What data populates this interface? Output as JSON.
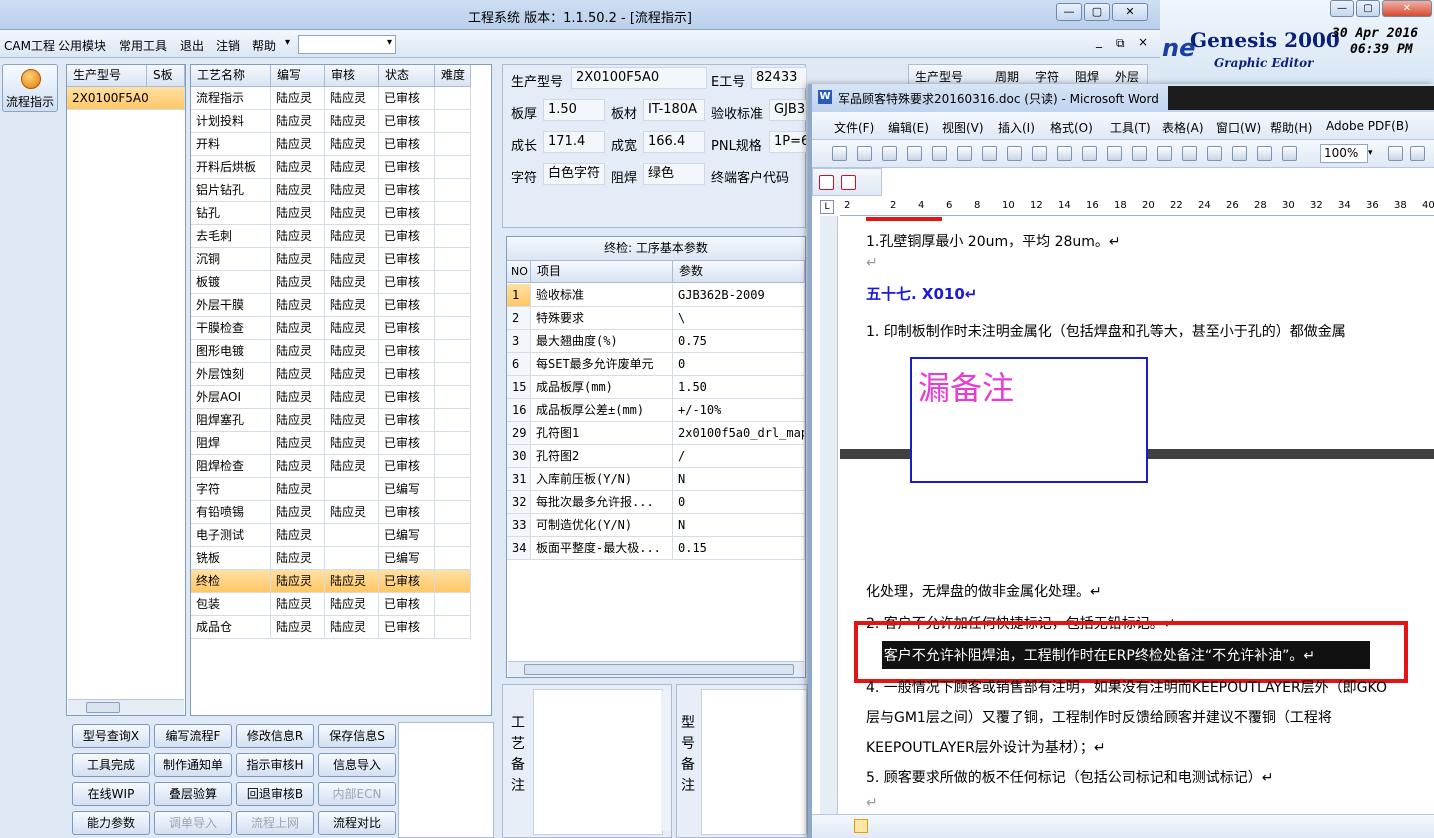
{
  "app": {
    "title": "工程系统   版本：1.1.50.2 - [流程指示]",
    "win_controls": [
      "—",
      "▢",
      "✕"
    ],
    "menu": [
      "CAM工程",
      "公用模块",
      "常用工具",
      "退出",
      "注销",
      "帮助"
    ],
    "menu_arrow": "▾",
    "nav_label": "流程指示",
    "mdi_controls": [
      "_",
      "⧉",
      "×"
    ]
  },
  "left_list": {
    "headers": [
      "生产型号",
      "S板"
    ],
    "rows": [
      {
        "model": "2X0100F5A0",
        "s": ""
      }
    ]
  },
  "process": {
    "headers": [
      "工艺名称",
      "编写",
      "审核",
      "状态",
      "难度"
    ],
    "rows": [
      [
        "流程指示",
        "陆应灵",
        "陆应灵",
        "已审核",
        ""
      ],
      [
        "计划投料",
        "陆应灵",
        "陆应灵",
        "已审核",
        ""
      ],
      [
        "开料",
        "陆应灵",
        "陆应灵",
        "已审核",
        ""
      ],
      [
        "开料后烘板",
        "陆应灵",
        "陆应灵",
        "已审核",
        ""
      ],
      [
        "铝片钻孔",
        "陆应灵",
        "陆应灵",
        "已审核",
        ""
      ],
      [
        "钻孔",
        "陆应灵",
        "陆应灵",
        "已审核",
        ""
      ],
      [
        "去毛刺",
        "陆应灵",
        "陆应灵",
        "已审核",
        ""
      ],
      [
        "沉铜",
        "陆应灵",
        "陆应灵",
        "已审核",
        ""
      ],
      [
        "板镀",
        "陆应灵",
        "陆应灵",
        "已审核",
        ""
      ],
      [
        "外层干膜",
        "陆应灵",
        "陆应灵",
        "已审核",
        ""
      ],
      [
        "干膜检查",
        "陆应灵",
        "陆应灵",
        "已审核",
        ""
      ],
      [
        "图形电镀",
        "陆应灵",
        "陆应灵",
        "已审核",
        ""
      ],
      [
        "外层蚀刻",
        "陆应灵",
        "陆应灵",
        "已审核",
        ""
      ],
      [
        "外层AOI",
        "陆应灵",
        "陆应灵",
        "已审核",
        ""
      ],
      [
        "阻焊塞孔",
        "陆应灵",
        "陆应灵",
        "已审核",
        ""
      ],
      [
        "阻焊",
        "陆应灵",
        "陆应灵",
        "已审核",
        ""
      ],
      [
        "阻焊检查",
        "陆应灵",
        "陆应灵",
        "已审核",
        ""
      ],
      [
        "字符",
        "陆应灵",
        "",
        "已编写",
        ""
      ],
      [
        "有铅喷锡",
        "陆应灵",
        "陆应灵",
        "已审核",
        ""
      ],
      [
        "电子测试",
        "陆应灵",
        "",
        "已编写",
        ""
      ],
      [
        "铣板",
        "陆应灵",
        "",
        "已编写",
        ""
      ],
      [
        "终检",
        "陆应灵",
        "陆应灵",
        "已审核",
        ""
      ],
      [
        "包装",
        "陆应灵",
        "陆应灵",
        "已审核",
        ""
      ],
      [
        "成品仓",
        "陆应灵",
        "陆应灵",
        "已审核",
        ""
      ]
    ],
    "selected_index": 21
  },
  "form": {
    "model_label": "生产型号",
    "model": "2X0100F5A0",
    "eno_label": "E工号",
    "eno": "82433",
    "thick_label": "板厚",
    "thick": "1.50",
    "material_label": "板材",
    "material": "IT-180A",
    "std_label": "验收标准",
    "std": "GJB3",
    "len_label": "成长",
    "len": "171.4",
    "wid_label": "成宽",
    "wid": "166.4",
    "pnl_label": "PNL规格",
    "pnl": "1P=6",
    "char_label": "字符",
    "char": "白色字符",
    "mask_label": "阻焊",
    "mask": "绿色",
    "cust_label": "终端客户代码",
    "hdr2": [
      "生产型号",
      "周期",
      "字符",
      "阻焊",
      "外层"
    ]
  },
  "params": {
    "title": "终检: 工序基本参数",
    "headers": [
      "NO",
      "项目",
      "参数"
    ],
    "rows": [
      [
        "1",
        "验收标准",
        "GJB362B-2009"
      ],
      [
        "2",
        "特殊要求",
        "\\"
      ],
      [
        "3",
        "最大翘曲度(%)",
        "0.75"
      ],
      [
        "6",
        "每SET最多允许废单元",
        "0"
      ],
      [
        "15",
        "成品板厚(mm)",
        "1.50"
      ],
      [
        "16",
        "成品板厚公差±(mm)",
        "+/-10%"
      ],
      [
        "29",
        "孔符图1",
        "2x0100f5a0_drl_map."
      ],
      [
        "30",
        "孔符图2",
        "/"
      ],
      [
        "31",
        "入库前压板(Y/N)",
        "N"
      ],
      [
        "32",
        "每批次最多允许报...",
        "0"
      ],
      [
        "33",
        "可制造优化(Y/N)",
        "N"
      ],
      [
        "34",
        "板面平整度-最大极...",
        "0.15"
      ]
    ]
  },
  "buttons": [
    {
      "label": "型号查询X",
      "enabled": true
    },
    {
      "label": "编写流程F",
      "enabled": true
    },
    {
      "label": "修改信息R",
      "enabled": true
    },
    {
      "label": "保存信息S",
      "enabled": true
    },
    {
      "label": "工具完成",
      "enabled": true
    },
    {
      "label": "制作通知单",
      "enabled": true
    },
    {
      "label": "指示审核H",
      "enabled": true
    },
    {
      "label": "信息导入",
      "enabled": true
    },
    {
      "label": "在线WIP",
      "enabled": true
    },
    {
      "label": "叠层验算",
      "enabled": true
    },
    {
      "label": "回退审核B",
      "enabled": true
    },
    {
      "label": "内部ECN",
      "enabled": false
    },
    {
      "label": "能力参数",
      "enabled": true
    },
    {
      "label": "调单导入",
      "enabled": false
    },
    {
      "label": "流程上网",
      "enabled": false
    },
    {
      "label": "流程对比",
      "enabled": true
    }
  ],
  "notes": {
    "process_note": "工艺备注",
    "model_note": "型号备注"
  },
  "genesis": {
    "title": "Genesis 2000",
    "subtitle": "Graphic Editor",
    "date": "30 Apr 2016",
    "time": "06:39 PM",
    "partial": "ne"
  },
  "word": {
    "title": "军品顾客特殊要求20160316.doc (只读) - Microsoft Word",
    "menu": [
      "文件(F)",
      "编辑(E)",
      "视图(V)",
      "插入(I)",
      "格式(O)",
      "工具(T)",
      "表格(A)",
      "窗口(W)",
      "帮助(H)",
      "Adobe PDF(B)"
    ],
    "zoom": "100%",
    "ruler": [
      "2",
      "2",
      "4",
      "6",
      "8",
      "10",
      "12",
      "14",
      "16",
      "18",
      "20",
      "22",
      "24",
      "26",
      "28",
      "30",
      "32",
      "34",
      "36",
      "38",
      "40"
    ],
    "lines": [
      "1.孔壁铜厚最小 20um，平均 28um。↵",
      "↵",
      "五十七.  X010↵",
      "1. 印制板制作时未注明金属化（包括焊盘和孔等大，甚至小于孔的）都做金属",
      "化处理，无焊盘的做非金属化处理。↵",
      "2. 客户不允许加任何快捷标记，包括无铅标记。↵",
      "3. 客户不允许补阻焊油，工程制作时在ERP终检处备注“不允许补油”。↵",
      "4.  一般情况下顾客或销售部有注明，如果没有注明而KEEPOUTLAYER层外（即GKO",
      "层与GM1层之间）又覆了铜，工程制作时反馈给顾客并建议不覆铜（工程将",
      "KEEPOUTLAYER层外设计为基材）；↵",
      "5. 顾客要求所做的板不任何标记（包括公司标记和电测试标记）↵",
      "↵"
    ],
    "annotation": "漏备注",
    "colors": {
      "heading": "#1a1ad6",
      "annotation": "#e63dd4",
      "box": "#1c1cc8",
      "highlight_bg": "#111111",
      "red_box": "#e21414"
    }
  }
}
